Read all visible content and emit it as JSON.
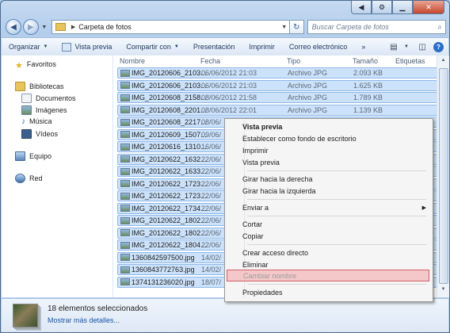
{
  "window": {
    "caption_buttons": [
      "previous-icon",
      "gear-icon",
      "minimize-icon",
      "close-icon"
    ]
  },
  "address": {
    "path": "Carpeta de fotos",
    "search_placeholder": "Buscar Carpeta de fotos"
  },
  "toolbar": {
    "organize": "Organizar",
    "preview": "Vista previa",
    "share": "Compartir con",
    "slideshow": "Presentación",
    "print": "Imprimir",
    "email": "Correo electrónico",
    "more": "»"
  },
  "nav": {
    "favorites": "Favoritos",
    "libraries": "Bibliotecas",
    "documents": "Documentos",
    "images": "Imágenes",
    "music": "Música",
    "videos": "Vídeos",
    "computer": "Equipo",
    "network": "Red"
  },
  "columns": {
    "name": "Nombre",
    "date": "Fecha",
    "type": "Tipo",
    "size": "Tamaño",
    "tags": "Etiquetas"
  },
  "files": [
    {
      "name": "IMG_20120606_2103...",
      "date": "06/06/2012 21:03",
      "type": "Archivo JPG",
      "size": "2.093 KB"
    },
    {
      "name": "IMG_20120606_2103...",
      "date": "06/06/2012 21:03",
      "type": "Archivo JPG",
      "size": "1.625 KB"
    },
    {
      "name": "IMG_20120608_2158...",
      "date": "08/06/2012 21:58",
      "type": "Archivo JPG",
      "size": "1.789 KB"
    },
    {
      "name": "IMG_20120608_2201...",
      "date": "08/06/2012 22:01",
      "type": "Archivo JPG",
      "size": "1.139 KB"
    },
    {
      "name": "IMG_20120608_2217...",
      "date": "08/06/",
      "type": "",
      "size": ""
    },
    {
      "name": "IMG_20120609_1507...",
      "date": "09/06/",
      "type": "",
      "size": ""
    },
    {
      "name": "IMG_20120616_1310...",
      "date": "16/06/",
      "type": "",
      "size": ""
    },
    {
      "name": "IMG_20120622_1632...",
      "date": "22/06/",
      "type": "",
      "size": ""
    },
    {
      "name": "IMG_20120622_1633...",
      "date": "22/06/",
      "type": "",
      "size": ""
    },
    {
      "name": "IMG_20120622_1723...",
      "date": "22/06/",
      "type": "",
      "size": ""
    },
    {
      "name": "IMG_20120622_1723...",
      "date": "22/06/",
      "type": "",
      "size": ""
    },
    {
      "name": "IMG_20120622_1734...",
      "date": "22/06/",
      "type": "",
      "size": ""
    },
    {
      "name": "IMG_20120622_1802...",
      "date": "22/06/",
      "type": "",
      "size": ""
    },
    {
      "name": "IMG_20120622_1802...",
      "date": "22/06/",
      "type": "",
      "size": ""
    },
    {
      "name": "IMG_20120622_1804...",
      "date": "22/06/",
      "type": "",
      "size": ""
    },
    {
      "name": "1360842597500.jpg",
      "date": "14/02/",
      "type": "",
      "size": ""
    },
    {
      "name": "1360843772763.jpg",
      "date": "14/02/",
      "type": "",
      "size": ""
    },
    {
      "name": "1374131236020.jpg",
      "date": "18/07/",
      "type": "",
      "size": ""
    }
  ],
  "context_menu": [
    {
      "label": "Vista previa"
    },
    {
      "label": "Establecer como fondo de escritorio"
    },
    {
      "label": "Imprimir"
    },
    {
      "label": "Vista previa"
    },
    {
      "label": "Girar hacia la derecha"
    },
    {
      "label": "Girar hacia la izquierda"
    },
    {
      "label": "Enviar a"
    },
    {
      "label": "Cortar"
    },
    {
      "label": "Copiar"
    },
    {
      "label": "Crear acceso directo"
    },
    {
      "label": "Eliminar"
    },
    {
      "label": "Cambiar nombre"
    },
    {
      "label": "Propiedades"
    }
  ],
  "status": {
    "selected": "18 elementos seleccionados",
    "more_details": "Mostrar más detalles..."
  }
}
